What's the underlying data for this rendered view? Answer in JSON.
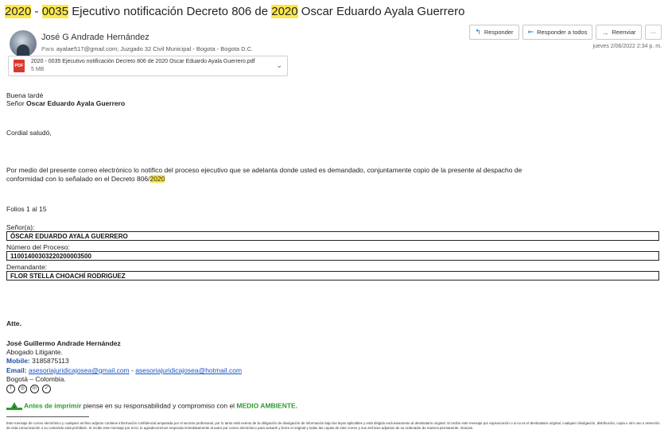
{
  "subject": {
    "p1": "2020",
    "p2": " - ",
    "p3": "0035",
    "p4": " Ejecutivo notificación Decreto 806 de ",
    "p5": "2020",
    "p6": " Oscar Eduardo Ayala Guerrero"
  },
  "sender": {
    "name": "José G Andrade Hernández",
    "to_label": "Para",
    "to_value": "ayalae517@gmail.com;  Juzgado 32 Civil Municipal - Bogota - Bogota D.C."
  },
  "attachment": {
    "icon_text": "PDF",
    "name": "2020 - 0035 Ejecutivo notificación Decreto 806 de 2020 Oscar Eduardo Ayala Guerrero.pdf",
    "size": "5 MB"
  },
  "actions": {
    "reply": "Responder",
    "reply_all": "Responder a todos",
    "forward": "Reenviar",
    "more": "···"
  },
  "date": "jueves 2/06/2022 2:34 p. m.",
  "body": {
    "greeting": "Buena tardé",
    "senor_prefix": "Señor ",
    "senor_name": "Oscar Eduardo Ayala Guerrero",
    "cordial": "Cordial saludó,",
    "para1": "Por medio del presente correo electrónico lo notifico del proceso ejecutivo que se adelanta donde usted es demandado, conjuntamente copio de la presente al despacho de",
    "para2_a": "conformidad con lo señalado en el Decreto 806/",
    "para2_b": "2020",
    "folios": "Folios 1 al 15"
  },
  "table": {
    "label1": "Señor(a):",
    "value1": "ÓSCAR EDUARDO AYALA GUERRERO",
    "label2": "Número del Proceso:",
    "value2": "11001400303220200003500",
    "label3": "Demandante:",
    "value3": "FLOR STELLA CHOACHÍ RODRIGUEZ"
  },
  "signature": {
    "atte": "Atte.",
    "name": "José Guillermo Andrade Hernández",
    "title": "Abogado Litigante.",
    "mobile_label": "Mobile:",
    "mobile_value": " 3185875113",
    "email_label": "Email:",
    "email1": "asesoriajuridicajosea@gmail.com",
    "email_sep": " - ",
    "email2": "asesoriajuridicajosea@hotmail.com",
    "city": "Bogotá – Colombia.",
    "social": [
      "f",
      "◎",
      "in",
      "✓"
    ]
  },
  "eco": {
    "part1": "Antes de imprimir",
    "part2": " piense en su responsabilidad y compromiso con el ",
    "part3": "MEDIO AMBIENTE."
  },
  "disclaimer": "Este mensaje de correo electrónico y cualquier archivo adjunto contiene información confidencial amparada por el secreto profesional, por lo tanto está exento de la obligación de divulgación de información bajo las leyes aplicables y está dirigido exclusivamente al destinatario original. Si recibe este mensaje por equivocación o si no es el destinatario original, cualquier divulgación, distribución, copia u otro uso o retención de esta comunicación o su contenido está prohibido. Si recibe este mensaje por error, le agradeceremos responda inmediatamente al autor por correo electrónico para avisarle y borre el original y todas las copias de este correo y sus archivos adjuntos de su ordenador de manera permanente. Gracias.",
  "colors": {
    "highlight": "#fde74c",
    "link": "#1a56c4",
    "accent": "#2b6fc2",
    "eco_green": "#2f9a2f"
  }
}
